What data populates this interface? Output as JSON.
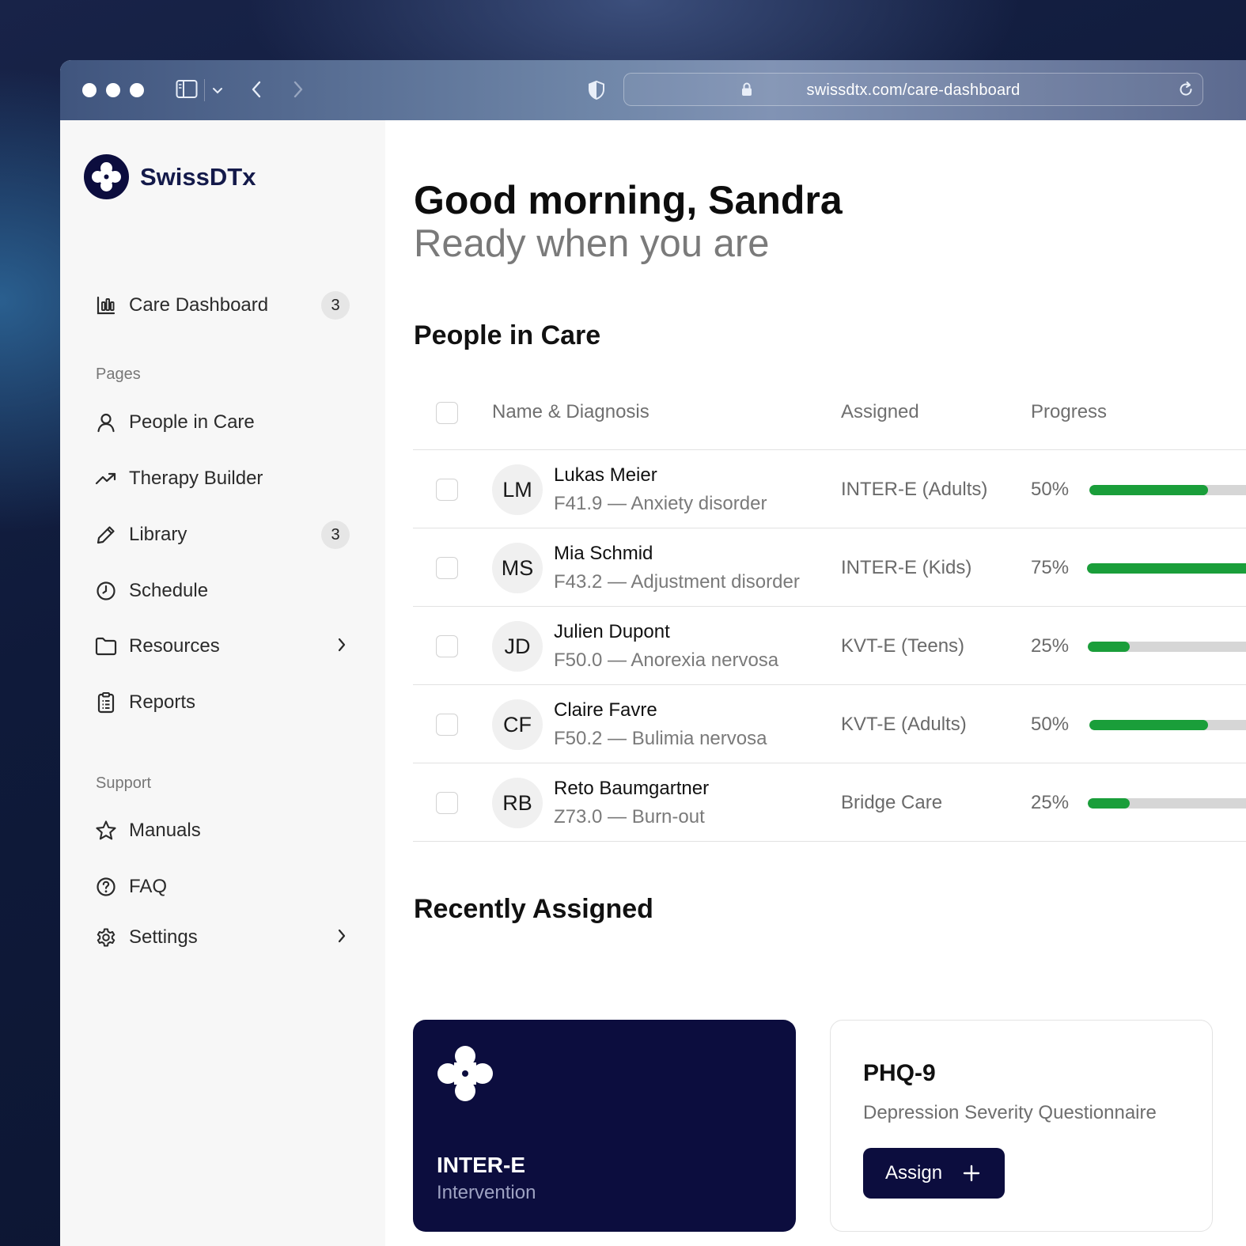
{
  "browser": {
    "url": "swissdtx.com/care-dashboard"
  },
  "sidebar": {
    "brand": "SwissDTx",
    "dashboard": {
      "label": "Care Dashboard",
      "badge": "3",
      "icon": "bar-chart-icon"
    },
    "pages_label": "Pages",
    "pages": [
      {
        "label": "People in Care",
        "icon": "user-icon"
      },
      {
        "label": "Therapy Builder",
        "icon": "trend-up-icon"
      },
      {
        "label": "Library",
        "icon": "pencil-icon",
        "badge": "3"
      },
      {
        "label": "Schedule",
        "icon": "clock-icon"
      },
      {
        "label": "Resources",
        "icon": "folder-icon",
        "chevron": true
      },
      {
        "label": "Reports",
        "icon": "clipboard-icon"
      }
    ],
    "support_label": "Support",
    "support": [
      {
        "label": "Manuals",
        "icon": "star-icon"
      },
      {
        "label": "FAQ",
        "icon": "help-circle-icon"
      },
      {
        "label": "Settings",
        "icon": "gear-icon",
        "chevron": true
      }
    ]
  },
  "main": {
    "greeting": "Good morning, Sandra",
    "subgreeting": "Ready when you are",
    "people_title": "People in Care",
    "table": {
      "headers": [
        "Name & Diagnosis",
        "Assigned",
        "Progress"
      ],
      "rows": [
        {
          "initials": "LM",
          "name": "Lukas Meier",
          "diagnosis": "F41.9 — Anxiety disorder",
          "assigned": "INTER-E (Adults)",
          "progress": "50%",
          "progress_value": 0.5
        },
        {
          "initials": "MS",
          "name": "Mia Schmid",
          "diagnosis": "F43.2 — Adjustment disorder",
          "assigned": "INTER-E (Kids)",
          "progress": "75%",
          "progress_value": 0.75
        },
        {
          "initials": "JD",
          "name": "Julien Dupont",
          "diagnosis": "F50.0 — Anorexia nervosa",
          "assigned": "KVT-E (Teens)",
          "progress": "25%",
          "progress_value": 0.25
        },
        {
          "initials": "CF",
          "name": "Claire Favre",
          "diagnosis": "F50.2 — Bulimia nervosa",
          "assigned": "KVT-E (Adults)",
          "progress": "50%",
          "progress_value": 0.5
        },
        {
          "initials": "RB",
          "name": "Reto Baumgartner",
          "diagnosis": "Z73.0 — Burn-out",
          "assigned": "Bridge Care",
          "progress": "25%",
          "progress_value": 0.25
        }
      ]
    },
    "recent_title": "Recently Assigned",
    "cards": {
      "intervention": {
        "title": "INTER-E",
        "subtitle": "Intervention",
        "icon": "swissdtx-logo-icon"
      },
      "questionnaire": {
        "title": "PHQ-9",
        "subtitle": "Depression Severity Questionnaire",
        "button": "Assign"
      }
    }
  },
  "colors": {
    "brand_navy": "#0c0d3e",
    "progress_green": "#1a9e3a",
    "progress_track": "#d6d6d6"
  }
}
